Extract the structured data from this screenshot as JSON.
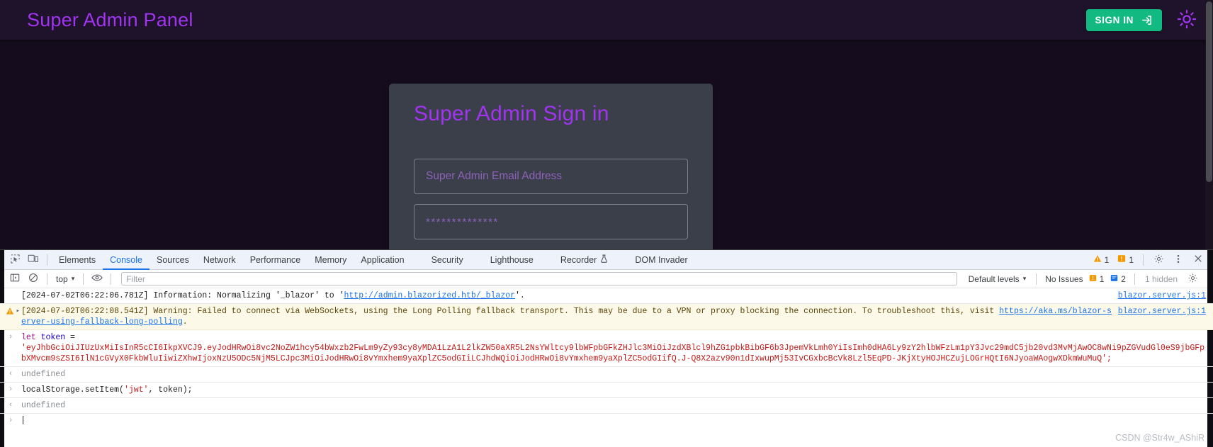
{
  "app": {
    "title": "Super Admin Panel",
    "sign_in_label": "SIGN IN",
    "sign_in_icon": "login-arrow-icon",
    "theme_icon": "sun-icon",
    "accent_purple": "#a134f0",
    "accent_green": "#12b981",
    "page_background": "#150d1e",
    "appbar_background": "#1f132b"
  },
  "login": {
    "heading": "Super Admin Sign in",
    "email_placeholder": "Super Admin Email Address",
    "email_value": "",
    "password_value": "**************",
    "card_background": "#3b3f4a"
  },
  "devtools": {
    "tabs": [
      {
        "label": "Elements",
        "active": false
      },
      {
        "label": "Console",
        "active": true
      },
      {
        "label": "Sources",
        "active": false
      },
      {
        "label": "Network",
        "active": false
      },
      {
        "label": "Performance",
        "active": false
      },
      {
        "label": "Memory",
        "active": false
      },
      {
        "label": "Application",
        "active": false
      },
      {
        "label": "Security",
        "active": false
      },
      {
        "label": "Lighthouse",
        "active": false
      },
      {
        "label": "Recorder",
        "active": false,
        "icon": "flask-icon"
      },
      {
        "label": "DOM Invader",
        "active": false
      }
    ],
    "inspect_icon": "inspect-element-icon",
    "device_icon": "device-toolbar-icon",
    "tabbar_right": {
      "warning_icon": "warning-triangle-icon",
      "warning_count": "1",
      "message_icon": "message-box-icon",
      "message_count": "1",
      "settings_icon": "gear-icon",
      "more_icon": "kebab-menu-icon",
      "close_icon": "close-icon"
    },
    "console_toolbar": {
      "sidebar_icon": "console-sidebar-icon",
      "clear_icon": "clear-console-icon",
      "context": "top",
      "context_caret": "▾",
      "eye_icon": "live-expression-eye-icon",
      "filter_placeholder": "Filter",
      "filter_value": "",
      "levels_label": "Default levels",
      "levels_caret": "▾",
      "issues_label": "No Issues",
      "issue_warning_count": "1",
      "issue_info_count": "2",
      "hidden_label": "1 hidden",
      "settings_icon": "gear-icon"
    },
    "messages": [
      {
        "kind": "log",
        "gutter": "",
        "text_prefix": "[2024-07-02T06:22:06.781Z] Information: Normalizing '_blazor' to '",
        "link": "http://admin.blazorized.htb/_blazor",
        "text_suffix": "'.",
        "source": "blazor.server.js:1"
      },
      {
        "kind": "warning",
        "gutter_icon": "warning-triangle-icon",
        "expander": "▸",
        "text_prefix": "[2024-07-02T06:22:08.541Z] Warning: Failed to connect via WebSockets, using the Long Polling fallback transport. This may be due to a VPN or proxy blocking the connection. To troubleshoot this, visit ",
        "link": "https://aka.ms/blazor-server-using-fallback-long-polling",
        "text_suffix": ".",
        "source": "blazor.server.js:1"
      },
      {
        "kind": "input",
        "gutter": "›",
        "code_keyword": "let",
        "code_var": "token",
        "code_eq": " =",
        "token_string": "'eyJhbGciOiJIUzUxMiIsInR5cCI6IkpXVCJ9.eyJodHRwOi8vc2NoZW1hcy54bWxzb2FwLm9yZy93cy8yMDA1LzA1L2lkZW50aXR5L2NsYWltcy9lbWFpbGFkZHJlc3MiOiJzdXBlcl9hZG1pbkBibGF6b3JpemVkLmh0YiIsImh0dHA6Ly9zY2hlbWFzLm1pY3Jvc29mdC5jb20vd3MvMjAwOC8wNi9pZGVudGl0eS9jbGFpbXMvcm9sZSI6IlN1cGVyX0FkbWluIiwiZXhwIjoxNzU5ODc5NjM5LCJpc3MiOiJodHRwOi8vYmxhem9yaXplZC5odGIiLCJhdWQiOiJodHRwOi8vYmxhem9yaXplZC5odGIifQ.J-Q8X2azv90n1dIxwupMj53IvCGxbcBcVk8Lzl5EqPD-JKjXtyHOJHCZujLOGrHQtI6NJyoaWAogwXDkmWuMuQ';"
      },
      {
        "kind": "result",
        "gutter": "‹",
        "text": "undefined"
      },
      {
        "kind": "input",
        "gutter": "›",
        "code_plain": "localStorage.setItem(",
        "code_string": "'jwt'",
        "code_tail": ", token);"
      },
      {
        "kind": "result",
        "gutter": "‹",
        "text": "undefined"
      },
      {
        "kind": "prompt",
        "gutter": "›",
        "text": ""
      }
    ]
  },
  "watermark": "CSDN @Str4w_AShiR"
}
